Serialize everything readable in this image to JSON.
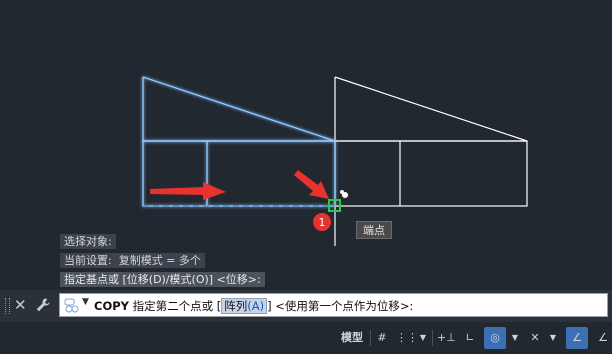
{
  "history": {
    "line1": "选择对象:",
    "line2": "当前设置:  复制模式 = 多个",
    "line3": "指定基点或 [位移(D)/模式(O)] <位移>:"
  },
  "tooltip": {
    "label": "端点"
  },
  "step_badge": {
    "number": "1"
  },
  "command": {
    "name": "COPY",
    "prompt_before": " 指定第二个点或 [",
    "option_label": "阵列",
    "option_key": "(A)",
    "prompt_after": "] <使用第一个点作为位移>:",
    "dropdown_icon": "chevron-down-icon",
    "command_icon": "command-history-icon"
  },
  "statusbar": {
    "model_label": "模型",
    "grid_icon": "grid-icon",
    "snap_icon": "snap-icon",
    "infer_icon": "infer-constraints-icon",
    "ortho_icon": "ortho-icon",
    "polar_icon": "polar-tracking-icon",
    "isodraft_icon": "isodraft-icon",
    "osnap_icon": "object-snap-icon"
  },
  "colors": {
    "background": "#212830",
    "selected_outline": "#8ec8ff",
    "geometry": "#ffffff",
    "arrow": "#e8322e",
    "snap_marker": "#2ec84a",
    "statusbar_active": "#3d6fb5"
  }
}
